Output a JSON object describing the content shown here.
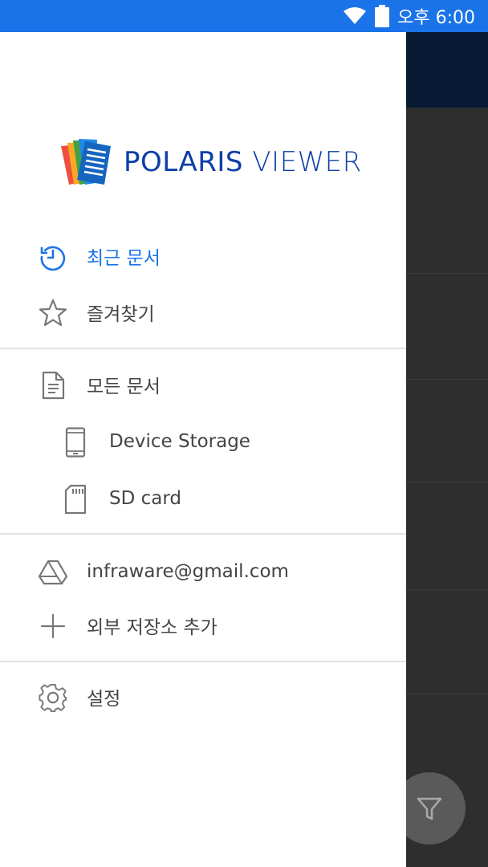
{
  "status_bar": {
    "time": "오후 6:00",
    "wifi_icon": "wifi-icon",
    "battery_icon": "battery-icon"
  },
  "logo": {
    "brand": "POLARIS",
    "product": "VIEWER"
  },
  "menu": {
    "recent": "최근 문서",
    "favorites": "즐겨찾기",
    "all_documents": "모든 문서",
    "device_storage": "Device Storage",
    "sd_card": "SD card",
    "account": "infraware@gmail.com",
    "add_storage": "외부 저장소 추가",
    "settings": "설정"
  },
  "colors": {
    "accent": "#1a73e8",
    "logo_blue": "#0d3ea8",
    "text": "#444444",
    "icon": "#777777"
  }
}
